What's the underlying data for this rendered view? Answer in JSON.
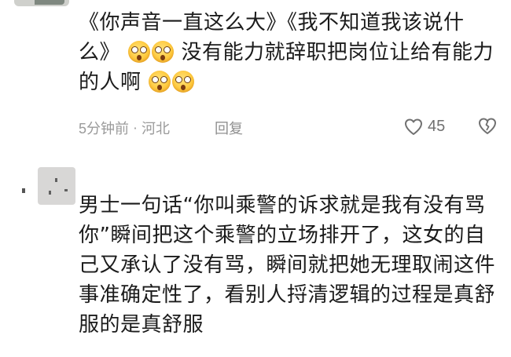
{
  "comments": [
    {
      "text_part1": "《你声音一直这么大》《我不知道我该说什么》",
      "emoji_a": "flushed-face",
      "emoji_b": "flushed-face",
      "text_part2": " 没有能力就辞职把岗位让给有能力的人啊",
      "emoji_c": "flushed-face",
      "emoji_d": "flushed-face",
      "time": "5分钟前",
      "separator": "·",
      "location": "河北",
      "reply_label": "回复",
      "like_count": "45"
    },
    {
      "text": "男士一句话“你叫乘警的诉求就是我有没有骂你”瞬间把这个乘警的立场排开了，这女的自己又承认了没有骂，瞬间就把她无理取闹这件事准确定性了，看别人捋清逻辑的过程是真舒服的是真舒服"
    }
  ],
  "colors": {
    "text": "#1b1b1b",
    "meta": "#9a9a9a",
    "icon": "#707070",
    "background": "#ffffff"
  }
}
